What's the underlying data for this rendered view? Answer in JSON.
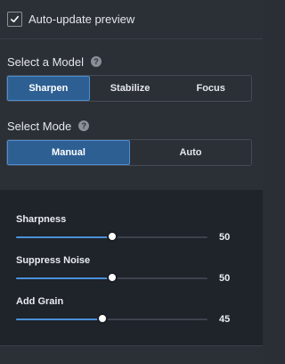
{
  "preview": {
    "checkbox_label": "Auto-update preview",
    "checked": true
  },
  "model": {
    "label": "Select a Model",
    "options": [
      "Sharpen",
      "Stabilize",
      "Focus"
    ],
    "selected": "Sharpen"
  },
  "mode": {
    "label": "Select Mode",
    "options": [
      "Manual",
      "Auto"
    ],
    "selected": "Manual"
  },
  "sliders": [
    {
      "label": "Sharpness",
      "value": "50",
      "level": 0.5
    },
    {
      "label": "Suppress Noise",
      "value": "50",
      "level": 0.5
    },
    {
      "label": "Add Grain",
      "value": "45",
      "level": 0.45
    }
  ],
  "colors": {
    "accent": "#2d5f93",
    "slider_fill": "#4b90d8"
  },
  "icons": {
    "checkbox": "check-icon",
    "help": "help-circle-icon"
  }
}
